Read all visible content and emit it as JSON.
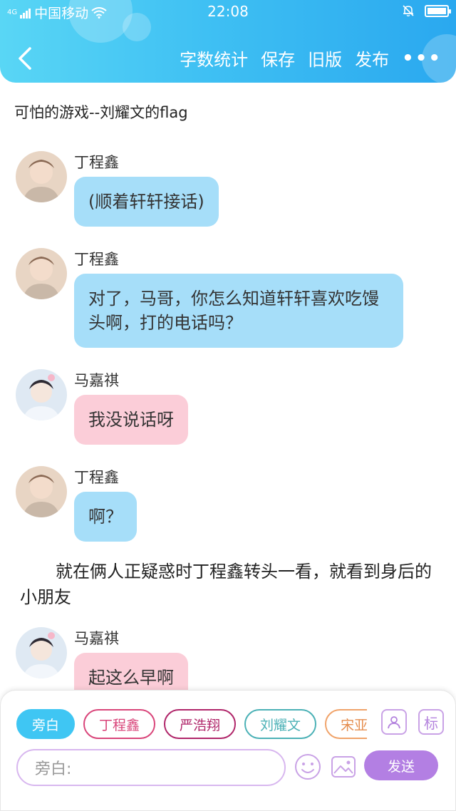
{
  "status_bar": {
    "carrier": "中国移动",
    "network": "4G",
    "time": "22:08"
  },
  "toolbar": {
    "actions": [
      "字数统计",
      "保存",
      "旧版",
      "发布"
    ],
    "more_label": "•••"
  },
  "story_title": "可怕的游戏--刘耀文的flag",
  "messages": [
    {
      "speaker": "丁程鑫",
      "text": "(顺着轩轩接话)",
      "color": "#a6def9"
    },
    {
      "speaker": "丁程鑫",
      "text": "对了，马哥，你怎么知道轩轩喜欢吃馒头啊，打的电话吗？",
      "color": "#a6def9"
    },
    {
      "speaker": "马嘉祺",
      "text": "我没说话呀",
      "color": "#fbcdd8"
    },
    {
      "speaker": "丁程鑫",
      "text": "啊？",
      "color": "#a6def9"
    },
    {
      "speaker": "马嘉祺",
      "text": "起这么早啊",
      "color": "#fbcdd8"
    }
  ],
  "narration": "就在俩人正疑惑时丁程鑫转头一看，就看到身后的小朋友",
  "role_chips": [
    "旁白",
    "丁程鑫",
    "严浩翔",
    "刘耀文",
    "宋亚轩"
  ],
  "tools": {
    "mark_label": "标"
  },
  "composer": {
    "placeholder": "旁白:",
    "send_label": "发送"
  },
  "colors": {
    "header_start": "#59d6f5",
    "header_end": "#2aa8ef",
    "blue_bubble": "#a6def9",
    "pink_bubble": "#fbcdd8",
    "send_button": "#b37fe3"
  }
}
